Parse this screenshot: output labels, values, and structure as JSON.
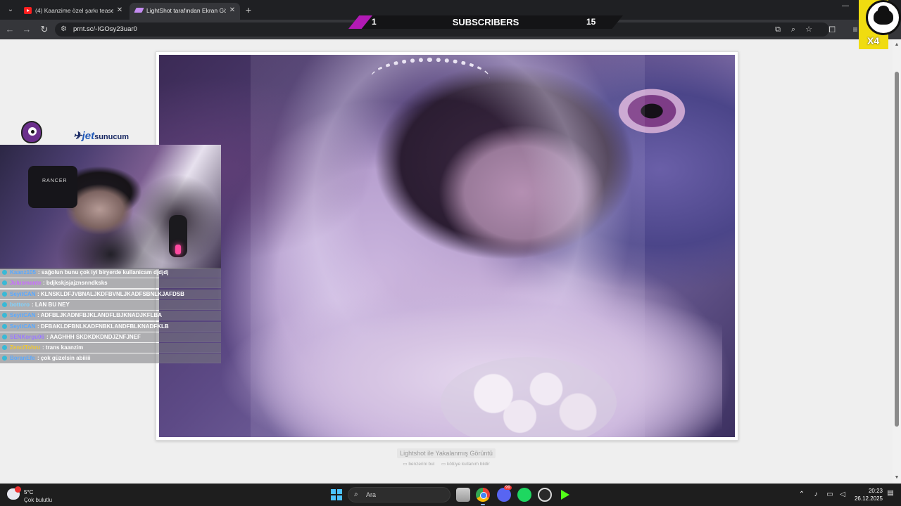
{
  "browser": {
    "tabs": [
      {
        "title": "(4) Kaanzime özel şarkı teaser |",
        "active": false,
        "favicon": "youtube-icon"
      },
      {
        "title": "LightShot tarafından Ekran Görü",
        "active": true,
        "favicon": "lightshot-icon"
      }
    ],
    "new_tab_label": "+",
    "url": "prnt.sc/-IGOsy23uar0"
  },
  "overlay": {
    "subscribers": {
      "current": "1",
      "label": "SUBSCRIBERS",
      "goal": "15"
    },
    "multiplier": "X4",
    "sponsor": {
      "brand_prefix": "jet",
      "brand_suffix": "sunucum"
    }
  },
  "webcam": {
    "chair_label": "RANCER"
  },
  "chat": [
    {
      "user": "Kaanz105",
      "user_color": "#5aa9ff",
      "message": "sağolun bunu çok iyi biryerde kullanicam djdjdj"
    },
    {
      "user": "Julusmante",
      "user_color": "#c86bff",
      "message": "bdjkskjsjajznsnndksks"
    },
    {
      "user": "SeyitCAN",
      "user_color": "#5aa9ff",
      "message": "KLNSKLDFJVBNALJKDFBVNLJKADFSBNLKJAFDSB"
    },
    {
      "user": "bottoro",
      "user_color": "#7fd3ff",
      "message": "LAN BU NEY"
    },
    {
      "user": "SeyitCAN",
      "user_color": "#5aa9ff",
      "message": "ADFBLJKADNFBJKLANDFLBJKNADJKFLBA"
    },
    {
      "user": "SeyitCAN",
      "user_color": "#5aa9ff",
      "message": "DFBAKLDFBNLKADFNBKLANDFBLKNADFKLB"
    },
    {
      "user": "SENKorgu06",
      "user_color": "#9b7bff",
      "message": "AAGHHH SKDKDKDNDJZNFJNEF"
    },
    {
      "user": "ZenciTohru",
      "user_color": "#f0c830",
      "message": "trans kaanzim"
    },
    {
      "user": "BoranEfe",
      "user_color": "#5aa9ff",
      "message": "çok güzelsin abiiiii"
    }
  ],
  "page": {
    "caption": "Lightshot ile Yakalanmış Görüntü",
    "link_similar": "benzerini bul",
    "link_report": "kötüye kullanım bildir"
  },
  "taskbar": {
    "weather": {
      "temp": "5°C",
      "desc": "Çok bulutlu"
    },
    "search_placeholder": "Ara",
    "discord_badge": "99",
    "clock_time": "20:23",
    "clock_date": "26.12.2025"
  },
  "colors": {
    "accent_purple": "#b21ab5",
    "page_bg": "#efefef",
    "taskbar_bg": "#1e1e1e"
  }
}
